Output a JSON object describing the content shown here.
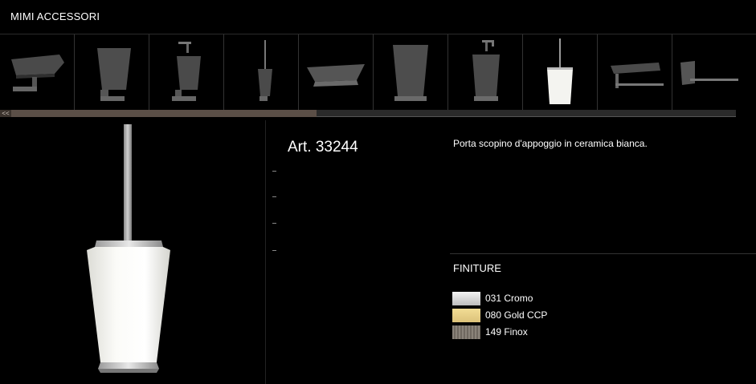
{
  "header": {
    "title": "MIMI ACCESSORI"
  },
  "thumbnails": [
    {
      "name": "soap-dish"
    },
    {
      "name": "tumbler-holder"
    },
    {
      "name": "soap-dispenser-wall"
    },
    {
      "name": "toilet-brush-wall"
    },
    {
      "name": "soap-dish-standing"
    },
    {
      "name": "tumbler-standing"
    },
    {
      "name": "soap-dispenser-standing"
    },
    {
      "name": "toilet-brush-standing"
    },
    {
      "name": "toilet-roll-holder"
    },
    {
      "name": "towel-ring"
    }
  ],
  "scrollbar": {
    "prev_label": "<<"
  },
  "product": {
    "art": "Art. 33244",
    "description": "Porta scopino d'appoggio in ceramica bianca."
  },
  "finishes": {
    "title": "FINITURE",
    "items": [
      {
        "label": "031 Cromo",
        "color": "#d9d9d9"
      },
      {
        "label": "080 Gold CCP",
        "color": "#e6cf86"
      },
      {
        "label": "149 Finox",
        "color": "#7d766d"
      }
    ]
  }
}
